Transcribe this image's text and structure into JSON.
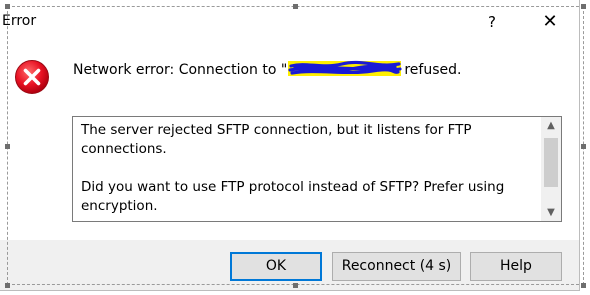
{
  "window": {
    "title": "Error",
    "help_glyph": "?",
    "close_glyph": "✕"
  },
  "message": {
    "prefix": "Network error: Connection to \"",
    "suffix": "refused.",
    "icon": "error-icon",
    "icon_color": "#e81123"
  },
  "details": {
    "line1": "The server rejected SFTP connection, but it listens for FTP connections.",
    "line2": "Did you want to use FTP protocol instead of SFTP? Prefer using encryption."
  },
  "buttons": {
    "ok_label": "OK",
    "reconnect_label": "Reconnect (4 s)",
    "help_label": "Help"
  },
  "colors": {
    "redaction_highlight": "#ffef00",
    "redaction_scribble": "#1a1ad6",
    "default_button_border": "#0078d7"
  }
}
